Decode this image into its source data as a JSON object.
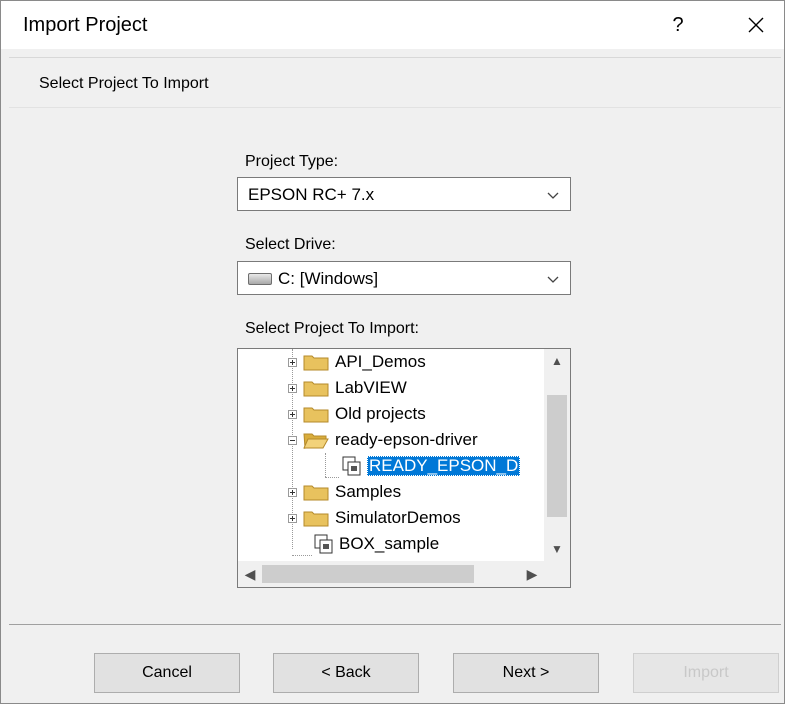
{
  "dialog": {
    "title": "Import Project",
    "help_label": "?",
    "header_text": "Select Project To Import"
  },
  "form": {
    "project_type_label": "Project Type:",
    "project_type_value": "EPSON RC+ 7.x",
    "drive_label": "Select Drive:",
    "drive_value": "C: [Windows]",
    "project_label": "Select Project To Import:"
  },
  "tree": {
    "items": [
      {
        "label": "API_Demos",
        "icon": "folder-icon",
        "expander": "plus"
      },
      {
        "label": "LabVIEW",
        "icon": "folder-icon",
        "expander": "plus"
      },
      {
        "label": "Old projects",
        "icon": "folder-icon",
        "expander": "plus"
      },
      {
        "label": "ready-epson-driver",
        "icon": "open-folder-icon",
        "expander": "minus"
      },
      {
        "label": "READY_EPSON_D",
        "icon": "project-icon",
        "selected": true
      },
      {
        "label": "Samples",
        "icon": "folder-icon",
        "expander": "plus"
      },
      {
        "label": "SimulatorDemos",
        "icon": "folder-icon",
        "expander": "plus"
      },
      {
        "label": "BOX_sample",
        "icon": "project-icon"
      }
    ]
  },
  "buttons": {
    "cancel": "Cancel",
    "back": "< Back",
    "next": "Next >",
    "import": "Import"
  },
  "colors": {
    "selection": "#0078d7",
    "folder": "#e8c25e"
  }
}
